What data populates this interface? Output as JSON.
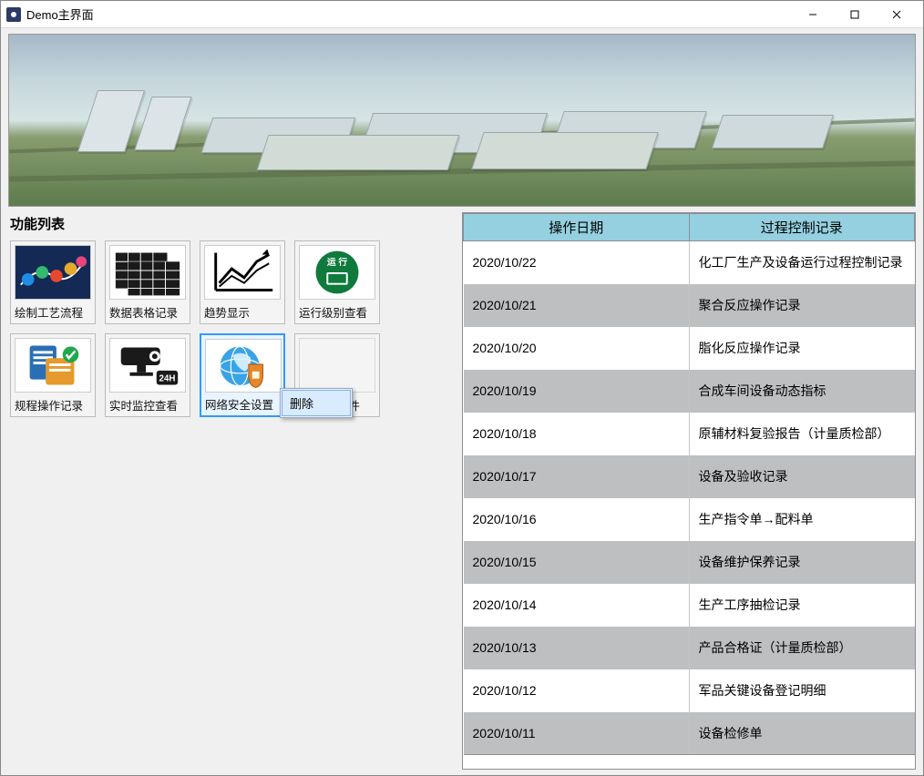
{
  "window": {
    "title": "Demo主界面"
  },
  "left": {
    "section_title": "功能列表",
    "tiles": [
      {
        "label": "绘制工艺流程"
      },
      {
        "label": "数据表格记录"
      },
      {
        "label": "趋势显示"
      },
      {
        "label": "运行级别查看"
      },
      {
        "label": "规程操作记录"
      },
      {
        "label": "实时监控查看"
      },
      {
        "label": "网络安全设置"
      },
      {
        "label": "添加插件"
      }
    ],
    "context_menu": {
      "delete": "删除"
    }
  },
  "table": {
    "headers": {
      "date": "操作日期",
      "record": "过程控制记录"
    },
    "rows": [
      {
        "date": "2020/10/22",
        "record": "化工厂生产及设备运行过程控制记录"
      },
      {
        "date": "2020/10/21",
        "record": "聚合反应操作记录"
      },
      {
        "date": "2020/10/20",
        "record": "脂化反应操作记录"
      },
      {
        "date": "2020/10/19",
        "record": "合成车间设备动态指标"
      },
      {
        "date": "2020/10/18",
        "record": "原辅材料复验报告（计量质检部）"
      },
      {
        "date": "2020/10/17",
        "record": "设备及验收记录"
      },
      {
        "date": "2020/10/16",
        "record": "生产指令单→配料单"
      },
      {
        "date": "2020/10/15",
        "record": "设备维护保养记录"
      },
      {
        "date": "2020/10/14",
        "record": "生产工序抽检记录"
      },
      {
        "date": "2020/10/13",
        "record": "产品合格证（计量质检部）"
      },
      {
        "date": "2020/10/12",
        "record": "军品关键设备登记明细"
      },
      {
        "date": "2020/10/11",
        "record": "设备检修单"
      }
    ]
  }
}
